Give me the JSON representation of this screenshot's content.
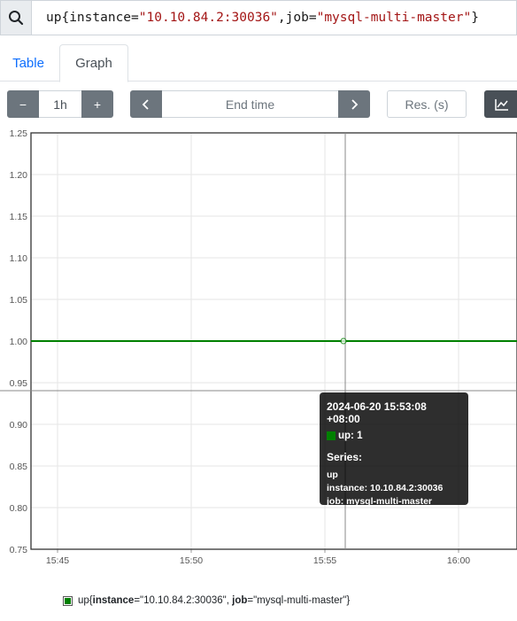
{
  "query": {
    "icon": "search-icon",
    "metric": "up",
    "label1_name": "instance",
    "label1_value": "\"10.10.84.2:30036\"",
    "label2_name": "job",
    "label2_value": "\"mysql-multi-master\""
  },
  "tabs": [
    {
      "label": "Table"
    },
    {
      "label": "Graph"
    }
  ],
  "controls": {
    "range_minus": "−",
    "range_value": "1h",
    "range_plus": "+",
    "end_prev": "‹",
    "end_time_placeholder": "End time",
    "end_next": "›",
    "resolution_placeholder": "Res. (s)",
    "chart_type_icon": "line-chart-icon"
  },
  "colors": {
    "series": "#008000",
    "accent": "#0d6efd"
  },
  "chart_data": {
    "type": "line",
    "y_ticks": [
      "1.25",
      "1.20",
      "1.15",
      "1.10",
      "1.05",
      "1.00",
      "0.95",
      "0.90",
      "0.85",
      "0.80",
      "0.75"
    ],
    "ylim": [
      0.75,
      1.25
    ],
    "x_ticks": [
      "15:45",
      "15:50",
      "15:55",
      "16:00"
    ],
    "grid": true,
    "series": [
      {
        "values": [
          1,
          1
        ],
        "hover_value": 1
      }
    ]
  },
  "tooltip": {
    "time": "2024-06-20 15:53:08 +08:00",
    "value_text": "up: 1",
    "series_title": "Series:",
    "metric": "up",
    "instance_line": "instance: 10.10.84.2:30036",
    "job_line": "job: mysql-multi-master"
  },
  "legend": {
    "prefix": "up{",
    "instance_key": "instance",
    "instance_val": "=\"10.10.84.2:30036\", ",
    "job_key": "job",
    "job_val": "=\"mysql-multi-master\"}"
  }
}
